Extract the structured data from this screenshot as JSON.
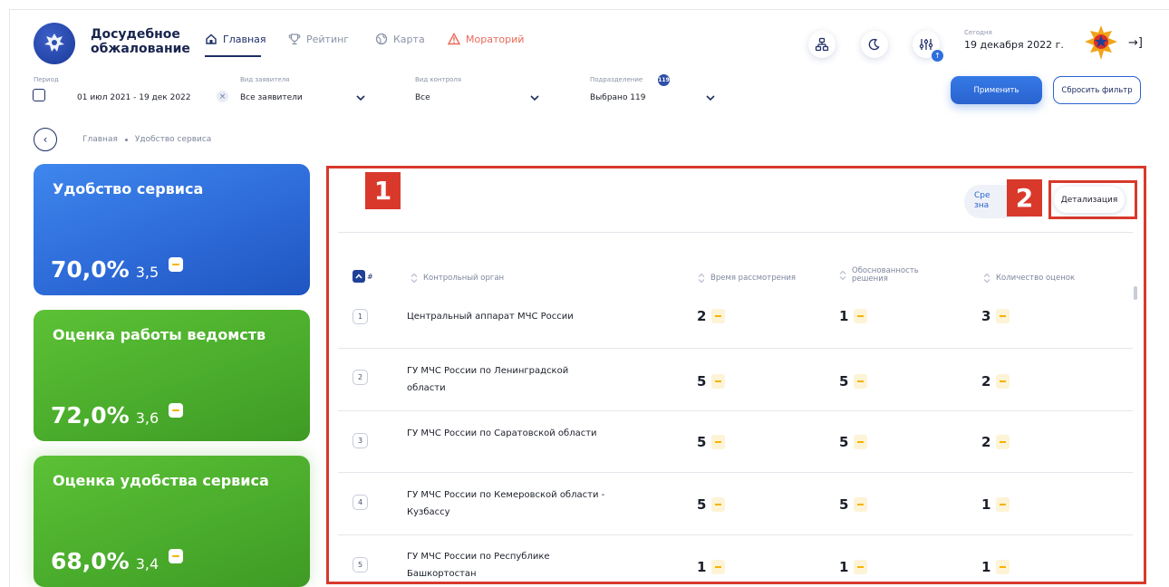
{
  "header": {
    "brand": "Досудебное обжалование",
    "nav": [
      {
        "label": "Главная",
        "icon": "home-icon",
        "active": true
      },
      {
        "label": "Рейтинг",
        "icon": "trophy-icon"
      },
      {
        "label": "Карта",
        "icon": "globe-icon"
      },
      {
        "label": "Мораторий",
        "icon": "warning-icon",
        "color": "#e86a5a"
      }
    ],
    "notification_count": "↑",
    "today_label": "Сегодня",
    "today_date": "19 декабря 2022 г."
  },
  "filters": {
    "period_label": "Период",
    "period_value": "01 июл 2021  -  19 дек 2022",
    "applicant_label": "Вид заявителя",
    "applicant_value": "Все заявители",
    "control_label": "Вид контроля",
    "control_value": "Все",
    "division_label": "Подразделение",
    "division_badge": "119",
    "division_value": "Выбрано 119",
    "apply": "Применить",
    "reset": "Сбросить фильтр"
  },
  "breadcrumb": {
    "items": [
      "Главная",
      "Удобство сервиса"
    ]
  },
  "cards": [
    {
      "title": "Удобство сервиса",
      "percent": "70,0%",
      "score": "3,5"
    },
    {
      "title": "Оценка работы ведомств",
      "percent": "72,0%",
      "score": "3,6"
    },
    {
      "title": "Оценка удобства сервиса",
      "percent": "68,0%",
      "score": "3,4"
    }
  ],
  "callouts": {
    "one": "1",
    "two": "2"
  },
  "toggle": {
    "left": "Сре\nзна",
    "right": "Детализация"
  },
  "table": {
    "headers": {
      "num": "#",
      "org": "Контрольный орган",
      "time": "Время рассмотрения",
      "valid": "Обоснованность решения",
      "count": "Количество оценок"
    },
    "rows": [
      {
        "n": "1",
        "org": "Центральный аппарат МЧС России",
        "time": "2",
        "valid": "1",
        "count": "3"
      },
      {
        "n": "2",
        "org": "ГУ МЧС России по Ленинградской области",
        "time": "5",
        "valid": "5",
        "count": "2"
      },
      {
        "n": "3",
        "org": "ГУ МЧС России по Саратовской области",
        "time": "5",
        "valid": "5",
        "count": "2"
      },
      {
        "n": "4",
        "org": "ГУ МЧС России по Кемеровской области - Кузбассу",
        "time": "5",
        "valid": "5",
        "count": "1"
      },
      {
        "n": "5",
        "org": "ГУ МЧС России по Республике Башкортостан",
        "time": "1",
        "valid": "1",
        "count": "1"
      }
    ]
  },
  "colors": {
    "accent": "#2a63cf",
    "navy": "#1f2e66",
    "highlight": "#d8392b",
    "card_blue": "#2d6bd8",
    "card_green": "#49ab2b",
    "warn": "#f4b400"
  }
}
